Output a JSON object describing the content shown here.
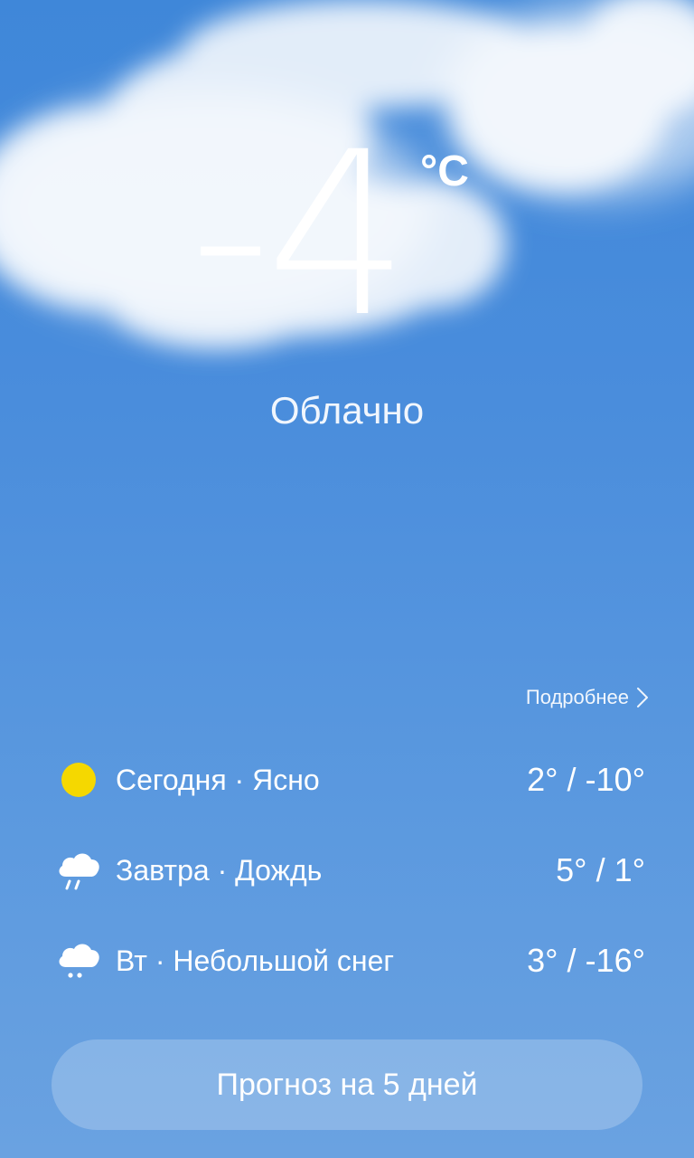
{
  "current": {
    "temperature": "-4",
    "unit": "°C",
    "condition": "Облачно"
  },
  "details_link": {
    "label": "Подробнее",
    "icon": "chevron-right-icon"
  },
  "forecast": [
    {
      "day": "Сегодня",
      "condition": "Ясно",
      "label": "Сегодня · Ясно",
      "range": "2° / -10°",
      "icon": "sun-icon",
      "icon_color": "#f5d800"
    },
    {
      "day": "Завтра",
      "condition": "Дождь",
      "label": "Завтра · Дождь",
      "range": "5° / 1°",
      "icon": "rain-icon",
      "icon_color": "#ffffff"
    },
    {
      "day": "Вт",
      "condition": "Небольшой снег",
      "label": "Вт · Небольшой снег",
      "range": "3° / -16°",
      "icon": "snow-icon",
      "icon_color": "#ffffff"
    }
  ],
  "forecast_button": {
    "label": "Прогноз на 5 дней"
  },
  "colors": {
    "background_top": "#3f87d9",
    "background_bottom": "#6aa2e1",
    "sun": "#f5d800"
  }
}
